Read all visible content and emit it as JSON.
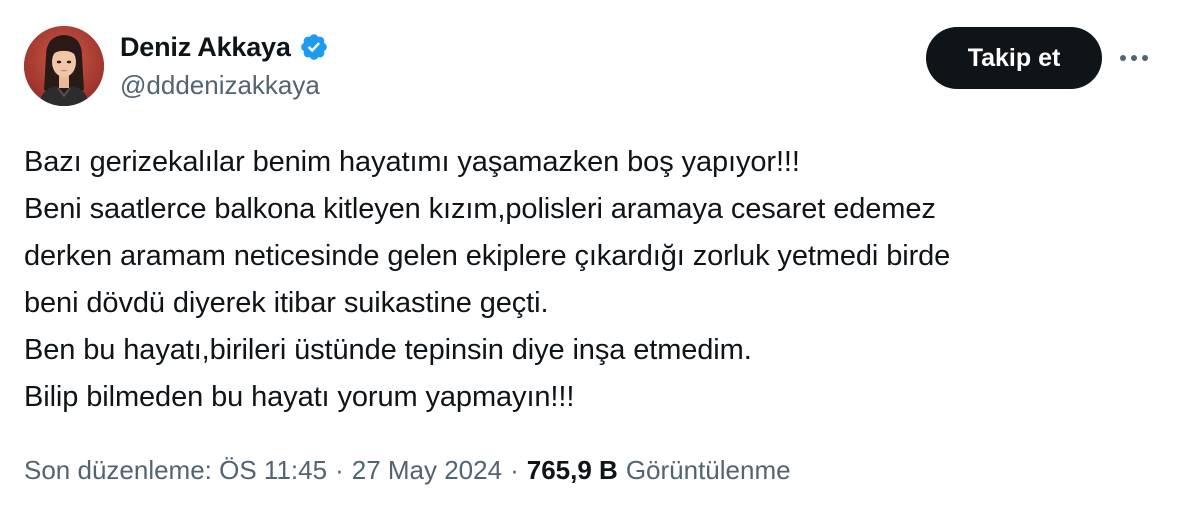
{
  "author": {
    "display_name": "Deniz Akkaya",
    "handle": "@dddenizakkaya",
    "verified_color": "#1d9bf0"
  },
  "actions": {
    "follow_label": "Takip et",
    "more_icon": "ellipsis-icon"
  },
  "tweet": {
    "lines": [
      "Bazı gerizekalılar benim hayatımı yaşamazken boş yapıyor!!!",
      "Beni saatlerce balkona kitleyen kızım,polisleri aramaya cesaret edemez",
      "derken aramam neticesinde gelen ekiplere çıkardığı zorluk yetmedi birde",
      "beni dövdü diyerek itibar suikastine geçti.",
      "Ben bu hayatı,birileri üstünde tepinsin diye inşa etmedim.",
      "Bilip bilmeden bu hayatı yorum yapmayın!!!"
    ]
  },
  "meta": {
    "edited_label": "Son düzenleme: ÖS 11:45",
    "separator": "·",
    "date": "27 May 2024",
    "views_count": "765,9 B",
    "views_label": "Görüntülenme"
  },
  "colors": {
    "text_primary": "#0f1419",
    "text_secondary": "#536471",
    "button_bg": "#0f1419",
    "verified": "#1d9bf0"
  }
}
